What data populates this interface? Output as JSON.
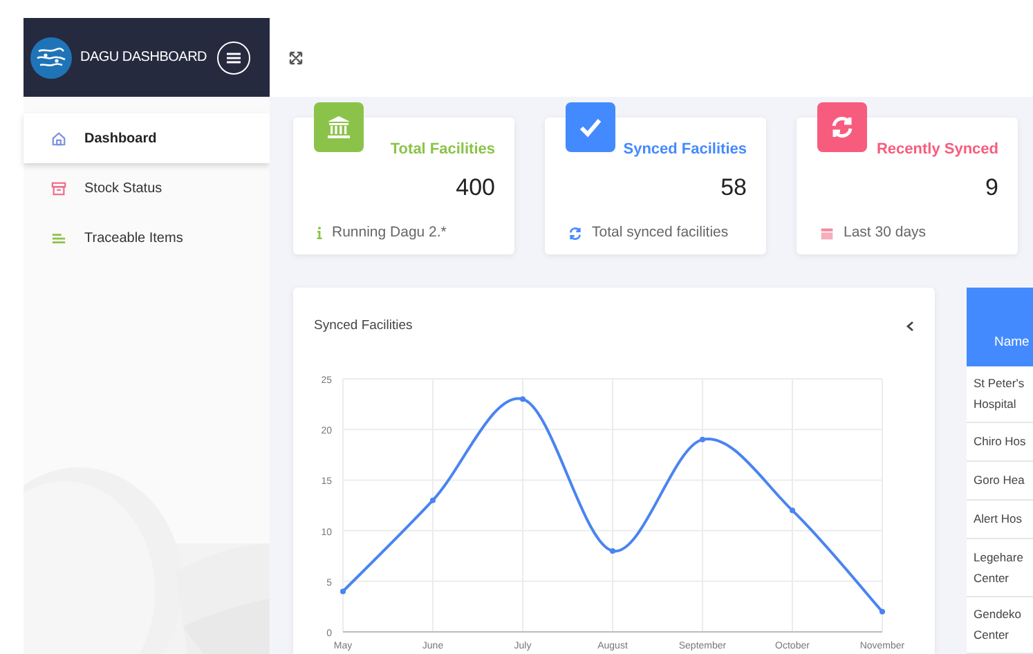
{
  "brand": {
    "title": "DAGU DASHBOARD"
  },
  "sidebar": {
    "items": [
      {
        "label": "Dashboard",
        "kind": "home",
        "selected": true
      },
      {
        "label": "Stock Status",
        "kind": "box",
        "selected": false
      },
      {
        "label": "Traceable Items",
        "kind": "list",
        "selected": false
      }
    ]
  },
  "cards": [
    {
      "title": "Total Facilities",
      "value": "400",
      "footer": "Running Dagu 2.*",
      "kind": "bank",
      "color": "#8bc34a"
    },
    {
      "title": "Synced Facilities",
      "value": "58",
      "footer": "Total synced facilities",
      "kind": "check",
      "color": "#448aff"
    },
    {
      "title": "Recently Synced",
      "value": "9",
      "footer": "Last 30 days",
      "kind": "sync",
      "color": "#f75c7e"
    }
  ],
  "chart_panel": {
    "chart_data": {
      "type": "line",
      "title": "Synced Facilities",
      "grid": true,
      "categories": [
        "May",
        "June",
        "July",
        "August",
        "September",
        "October",
        "November"
      ],
      "series": [
        {
          "color": "#4a84f0",
          "marker": true,
          "values": [
            4,
            13,
            23,
            8,
            19,
            12,
            2
          ]
        }
      ],
      "ylim": [
        0,
        25
      ],
      "yticks": [
        0,
        5,
        10,
        15,
        20,
        25
      ]
    }
  },
  "table": {
    "columns": [
      "Name"
    ],
    "rows": [
      "St Peter's Hospital",
      "Chiro Hos",
      "Goro Hea",
      "Alert Hos",
      "Legehare Center",
      "Gendeko Center"
    ]
  }
}
